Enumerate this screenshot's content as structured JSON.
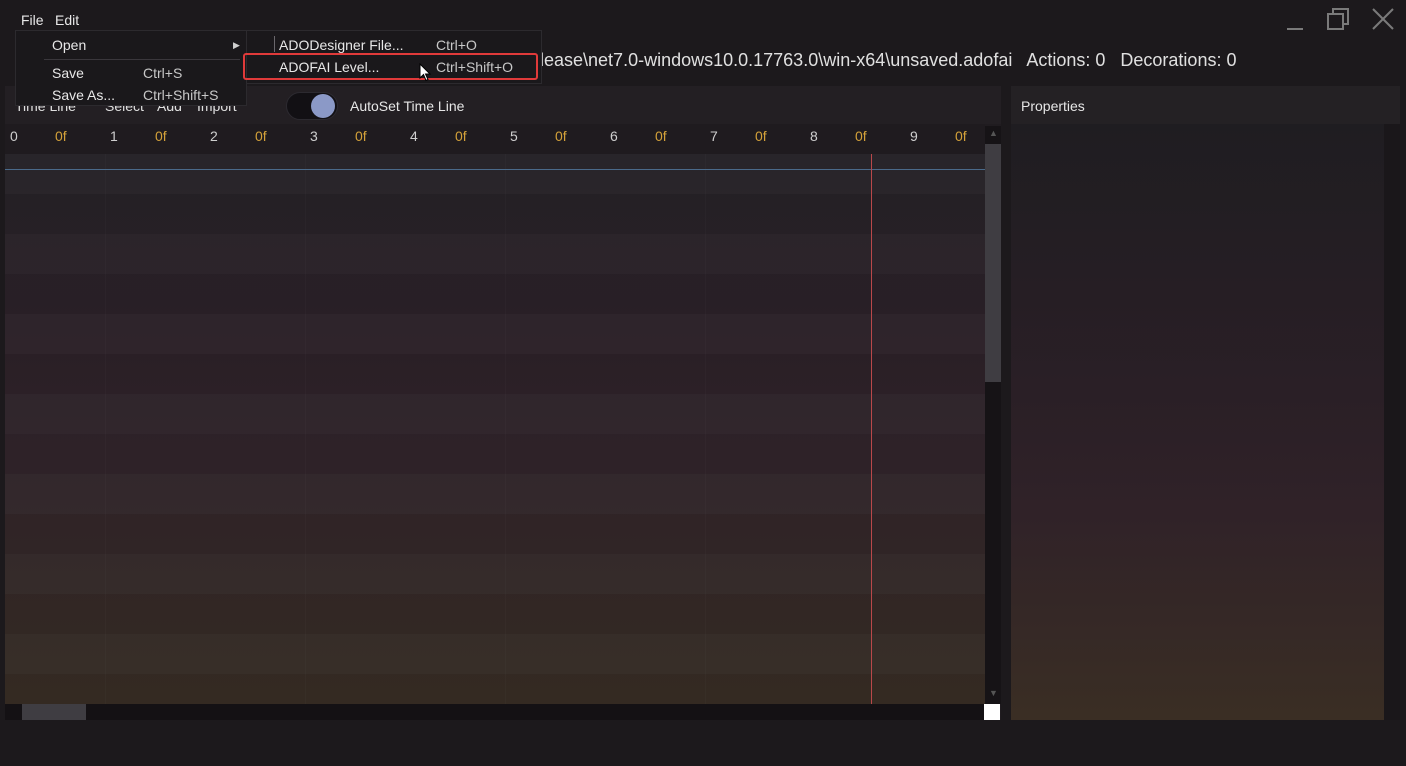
{
  "menubar": {
    "file": "File",
    "edit": "Edit"
  },
  "title_bar": {
    "path": "lease\\net7.0-windows10.0.17763.0\\win-x64\\unsaved.adofai",
    "actions": "Actions: 0",
    "decorations": "Decorations: 0"
  },
  "timeline": {
    "tabs": [
      "Time Line",
      "Select",
      "Add",
      "Import"
    ],
    "toggle_label": "AutoSet Time Line",
    "ruler": [
      {
        "n": "0",
        "f": "0f"
      },
      {
        "n": "1",
        "f": "0f"
      },
      {
        "n": "2",
        "f": "0f"
      },
      {
        "n": "3",
        "f": "0f"
      },
      {
        "n": "4",
        "f": "0f"
      },
      {
        "n": "5",
        "f": "0f"
      },
      {
        "n": "6",
        "f": "0f"
      },
      {
        "n": "7",
        "f": "0f"
      },
      {
        "n": "8",
        "f": "0f"
      },
      {
        "n": "9",
        "f": "0f"
      }
    ]
  },
  "properties": {
    "title": "Properties"
  },
  "file_menu": {
    "open": "Open",
    "save": "Save",
    "save_shortcut": "Ctrl+S",
    "save_as": "Save As...",
    "save_as_shortcut": "Ctrl+Shift+S"
  },
  "open_submenu": {
    "adodesigner": "ADODesigner File...",
    "adodesigner_shortcut": "Ctrl+O",
    "adofai": "ADOFAI Level...",
    "adofai_shortcut": "Ctrl+Shift+O"
  },
  "colors": {
    "accent_knob": "#8b99c7",
    "playhead": "#b9484a",
    "frame_label": "#d4a23a",
    "highlight": "#e03a3a"
  }
}
